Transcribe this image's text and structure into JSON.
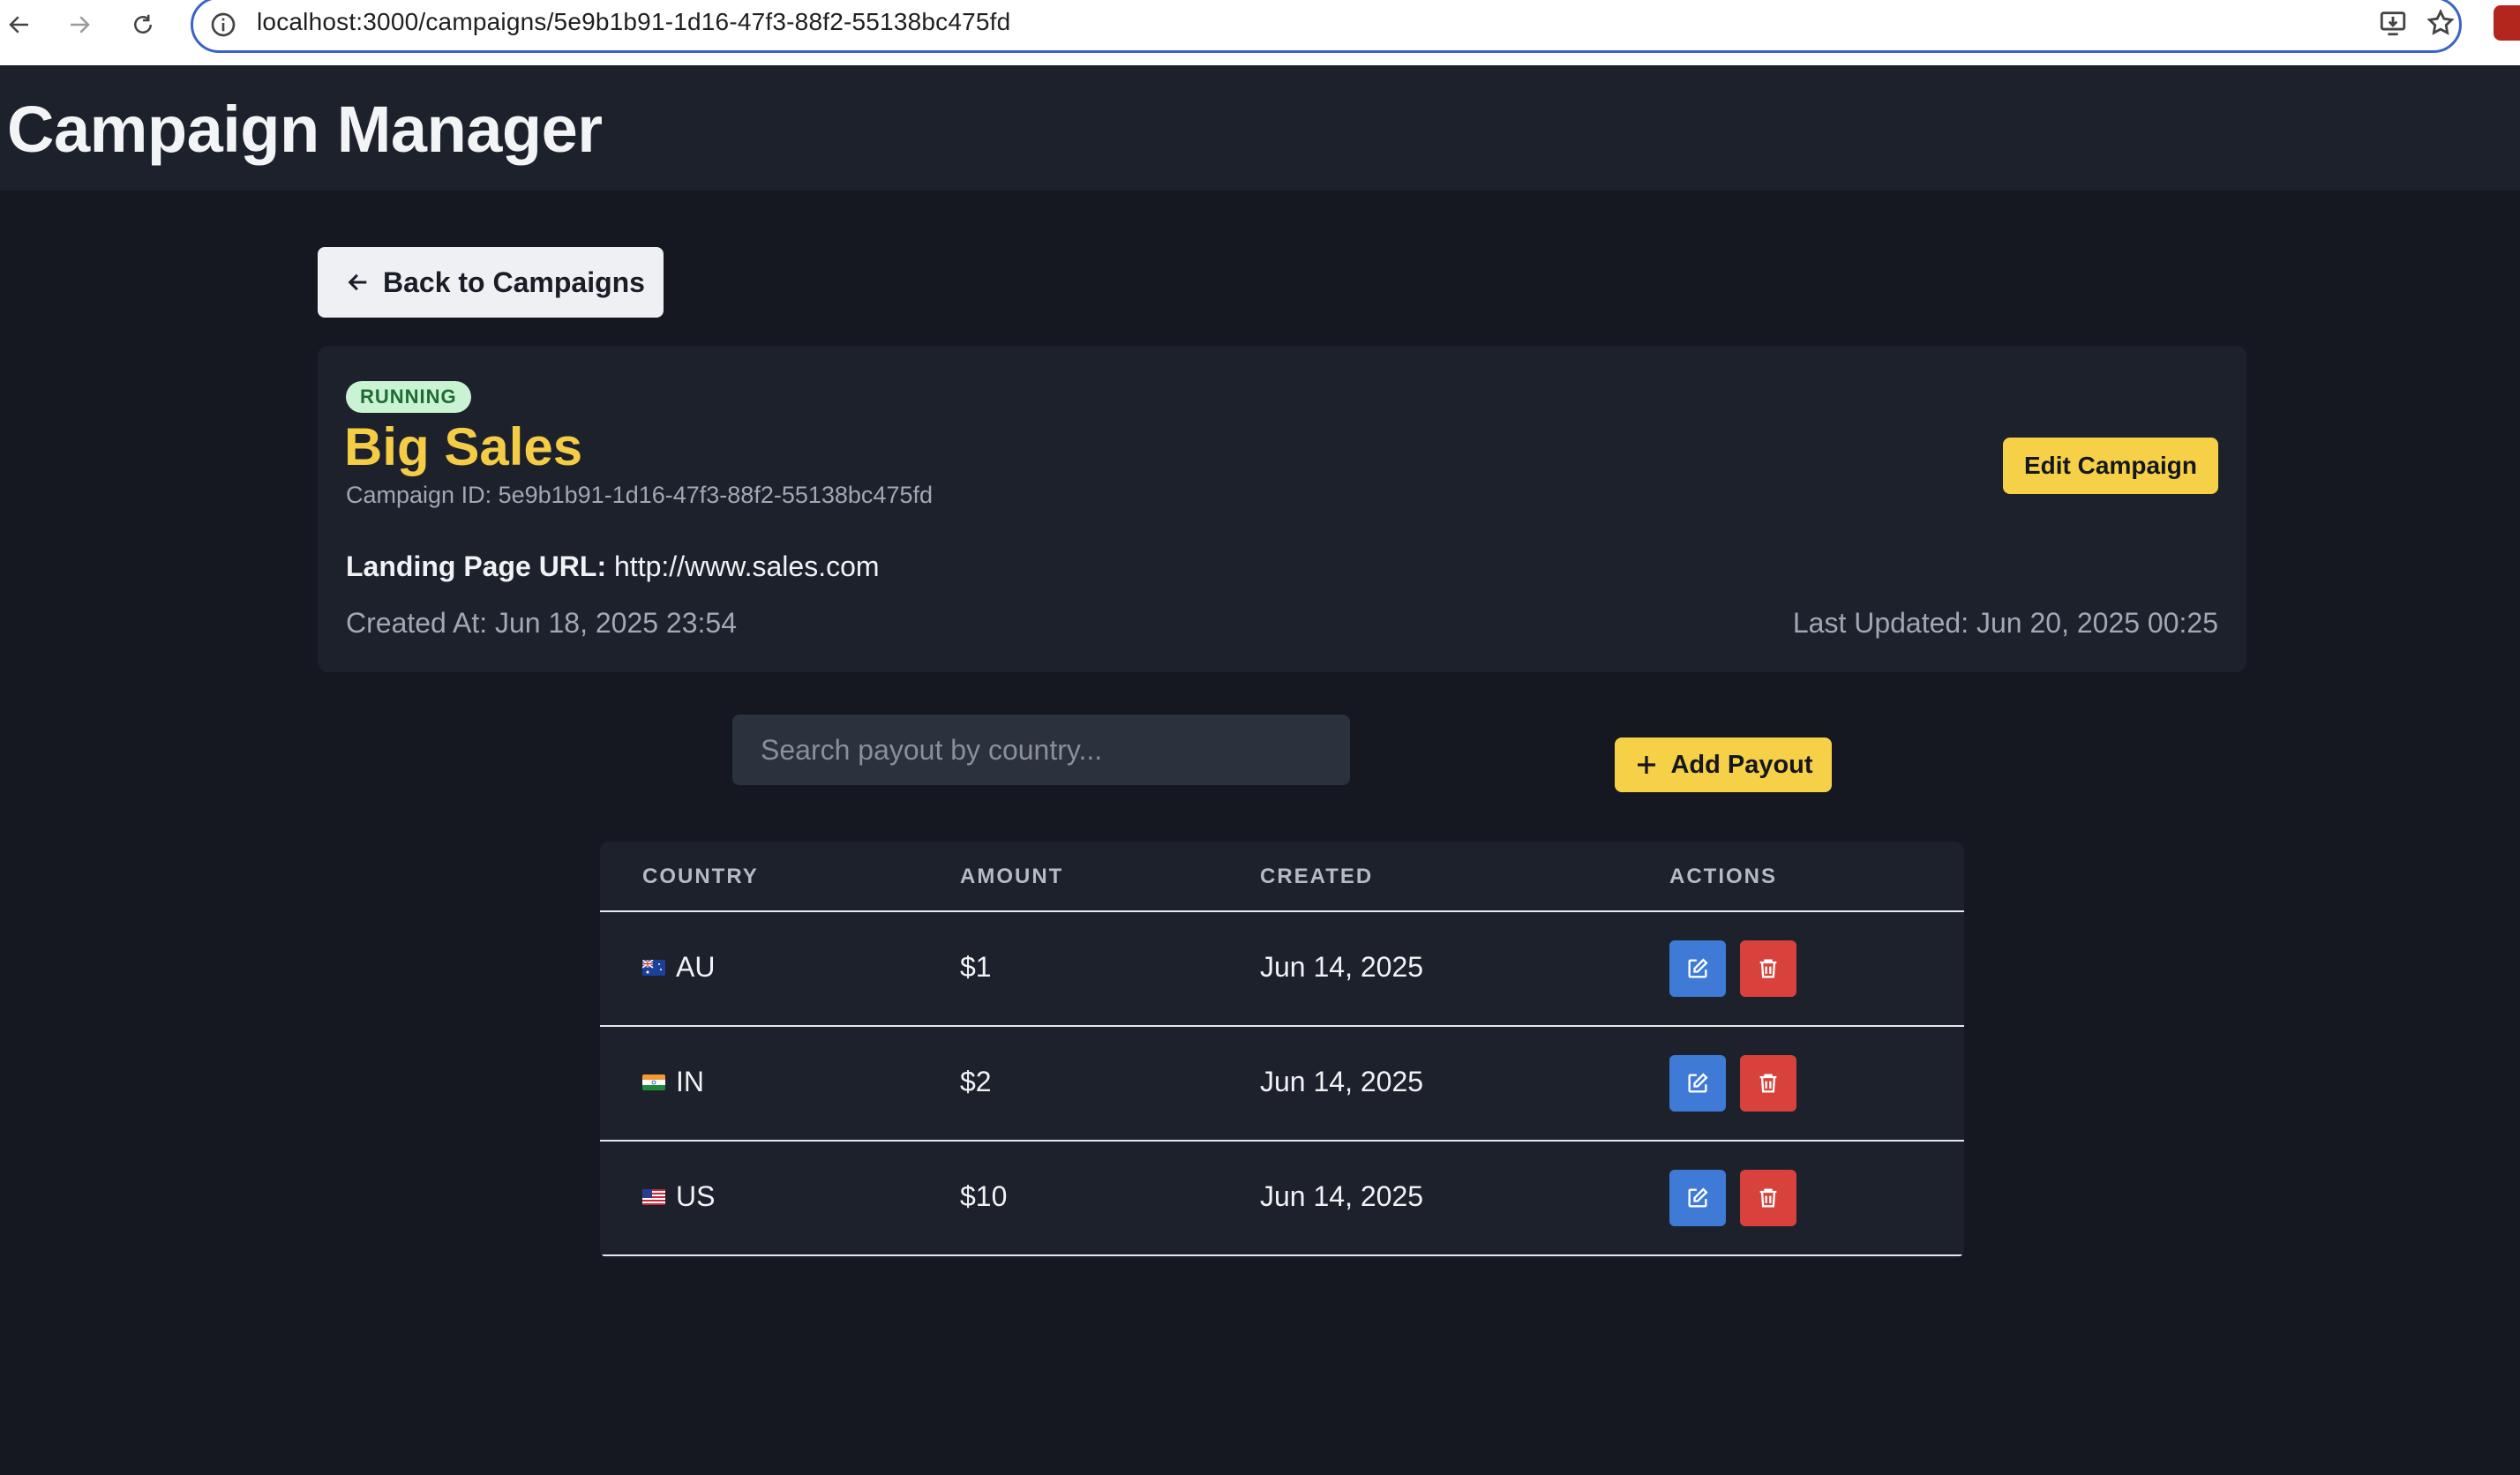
{
  "browser": {
    "url": "localhost:3000/campaigns/5e9b1b91-1d16-47f3-88f2-55138bc475fd"
  },
  "app": {
    "title": "Campaign Manager"
  },
  "back_button": {
    "label": "Back to Campaigns"
  },
  "campaign": {
    "status": "RUNNING",
    "name": "Big Sales",
    "id_text": "Campaign ID: 5e9b1b91-1d16-47f3-88f2-55138bc475fd",
    "landing_label": "Landing Page URL:",
    "landing_url": "http://www.sales.com",
    "created_at": "Created At: Jun 18, 2025 23:54",
    "last_updated": "Last Updated: Jun 20, 2025 00:25",
    "edit_label": "Edit Campaign"
  },
  "payouts": {
    "search_placeholder": "Search payout by country...",
    "add_label": "Add Payout",
    "columns": [
      "COUNTRY",
      "AMOUNT",
      "CREATED",
      "ACTIONS"
    ],
    "rows": [
      {
        "country": "AU",
        "amount": "$1",
        "created": "Jun 14, 2025"
      },
      {
        "country": "IN",
        "amount": "$2",
        "created": "Jun 14, 2025"
      },
      {
        "country": "US",
        "amount": "$10",
        "created": "Jun 14, 2025"
      }
    ]
  },
  "colors": {
    "accent_yellow": "#f6d148",
    "badge_green_bg": "#c9f3d3",
    "edit_blue": "#3f7ad6",
    "delete_red": "#d9423c"
  }
}
